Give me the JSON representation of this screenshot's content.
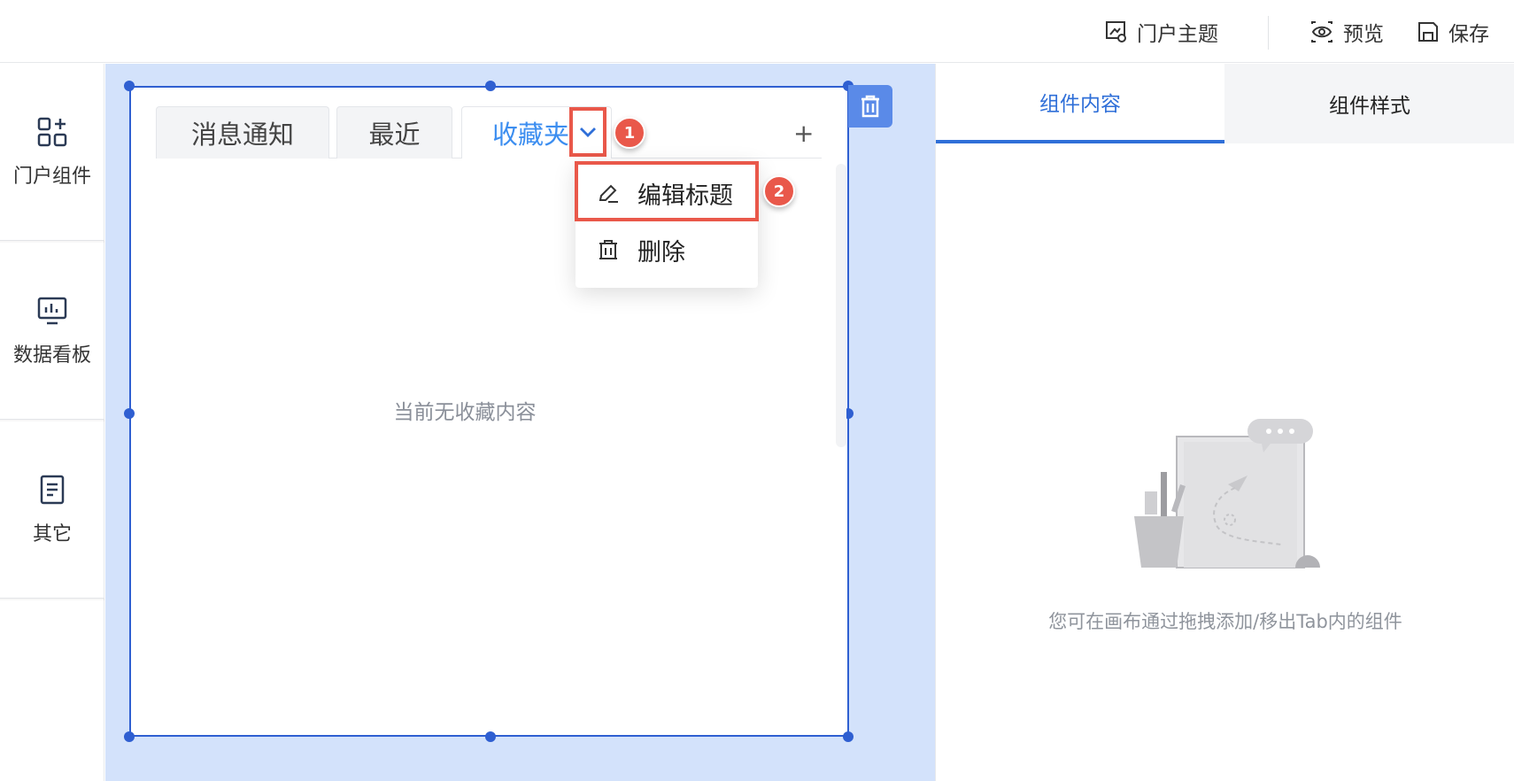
{
  "topbar": {
    "theme_label": "门户主题",
    "preview_label": "预览",
    "save_label": "保存"
  },
  "sidebar": {
    "items": [
      {
        "label": "门户组件",
        "icon": "widgets-icon"
      },
      {
        "label": "数据看板",
        "icon": "dashboard-icon"
      },
      {
        "label": "其它",
        "icon": "document-icon"
      }
    ]
  },
  "widget": {
    "tabs": [
      {
        "label": "消息通知",
        "active": false
      },
      {
        "label": "最近",
        "active": false
      },
      {
        "label": "收藏夹",
        "active": true
      }
    ],
    "add_tab_symbol": "+",
    "empty_text": "当前无收藏内容"
  },
  "dropdown": {
    "items": [
      {
        "label": "编辑标题",
        "icon": "edit-icon"
      },
      {
        "label": "删除",
        "icon": "trash-icon"
      }
    ]
  },
  "annotations": {
    "step1": "1",
    "step2": "2",
    "highlight_color": "#e9584a"
  },
  "right_panel": {
    "tabs": [
      {
        "label": "组件内容",
        "active": true
      },
      {
        "label": "组件样式",
        "active": false
      }
    ],
    "hint": "您可在画布通过拖拽添加/移出Tab内的组件"
  },
  "colors": {
    "accent": "#2f6fd8",
    "active_tab_text": "#3c8ef0",
    "canvas_bg": "#d3e2fb"
  }
}
